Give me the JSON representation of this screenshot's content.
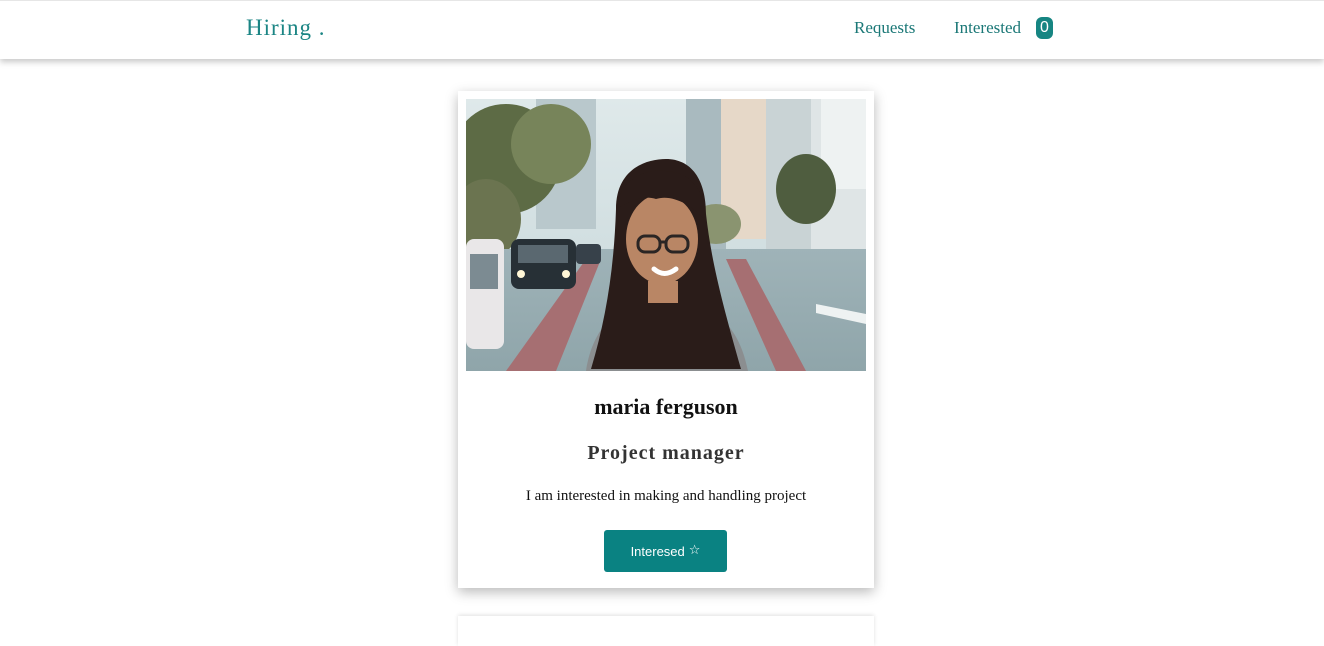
{
  "nav": {
    "brand": "Hiring .",
    "links": [
      {
        "label": "Requests"
      },
      {
        "label": "Interested"
      }
    ],
    "interested_count": "0"
  },
  "profiles": [
    {
      "name": "maria ferguson",
      "role": "Project manager",
      "bio": "I am interested in making and handling project",
      "button_label": "Interesed",
      "button_icon": "star-outline-icon"
    }
  ],
  "colors": {
    "accent": "#0a8282",
    "nav_text": "#1b7877",
    "card_bg": "#ffffff",
    "page_bg": "#ffffff"
  }
}
